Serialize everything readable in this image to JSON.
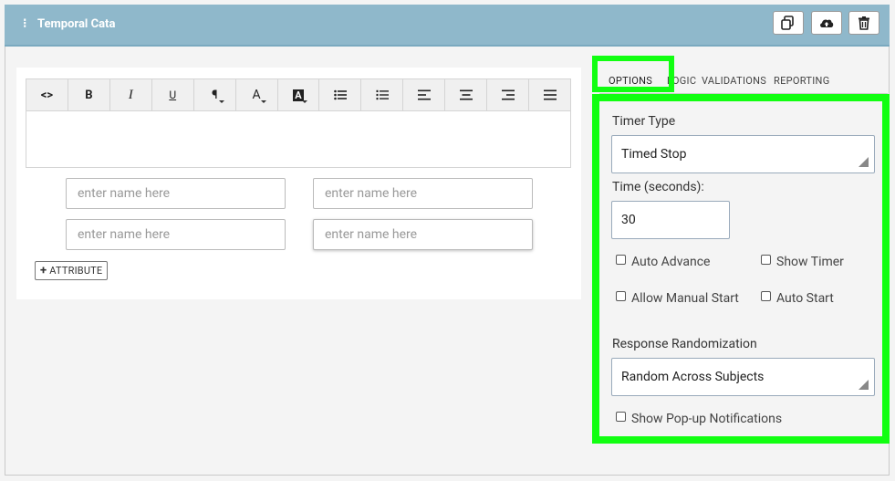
{
  "header": {
    "title": "Temporal Cata",
    "buttons": [
      {
        "icon": "copy-icon"
      },
      {
        "icon": "cloud-upload-icon"
      },
      {
        "icon": "trash-icon"
      }
    ]
  },
  "toolbar": {
    "items": [
      {
        "name": "code-view",
        "glyph": "<>"
      },
      {
        "name": "bold",
        "glyph": "B"
      },
      {
        "name": "italic",
        "glyph": "I"
      },
      {
        "name": "underline",
        "glyph": "U"
      },
      {
        "name": "paragraph",
        "glyph": "¶"
      },
      {
        "name": "font-color",
        "glyph": "A"
      },
      {
        "name": "background-color",
        "glyph": "A"
      },
      {
        "name": "bullet-list",
        "glyph": "bullet"
      },
      {
        "name": "numbered-list",
        "glyph": "numbered"
      },
      {
        "name": "align-left",
        "glyph": "left"
      },
      {
        "name": "align-center",
        "glyph": "center"
      },
      {
        "name": "align-right",
        "glyph": "right"
      },
      {
        "name": "align-justify",
        "glyph": "justify"
      }
    ]
  },
  "attributes": {
    "placeholder": "enter name here",
    "add_label": "ATTRIBUTE"
  },
  "tabs": [
    "OPTIONS",
    "LOGIC",
    "VALIDATIONS",
    "REPORTING"
  ],
  "options": {
    "timer_type_label": "Timer Type",
    "timer_type_value": "Timed Stop",
    "time_label": "Time (seconds):",
    "time_value": "30",
    "auto_advance": "Auto Advance",
    "show_timer": "Show Timer",
    "allow_manual_start": "Allow Manual Start",
    "auto_start": "Auto Start",
    "randomization_label": "Response Randomization",
    "randomization_value": "Random Across Subjects",
    "show_popups": "Show Pop-up Notifications"
  },
  "colors": {
    "header_bg": "#8fb8cb",
    "highlight": "#11ff11",
    "tab_underline": "#3c7ea6"
  }
}
